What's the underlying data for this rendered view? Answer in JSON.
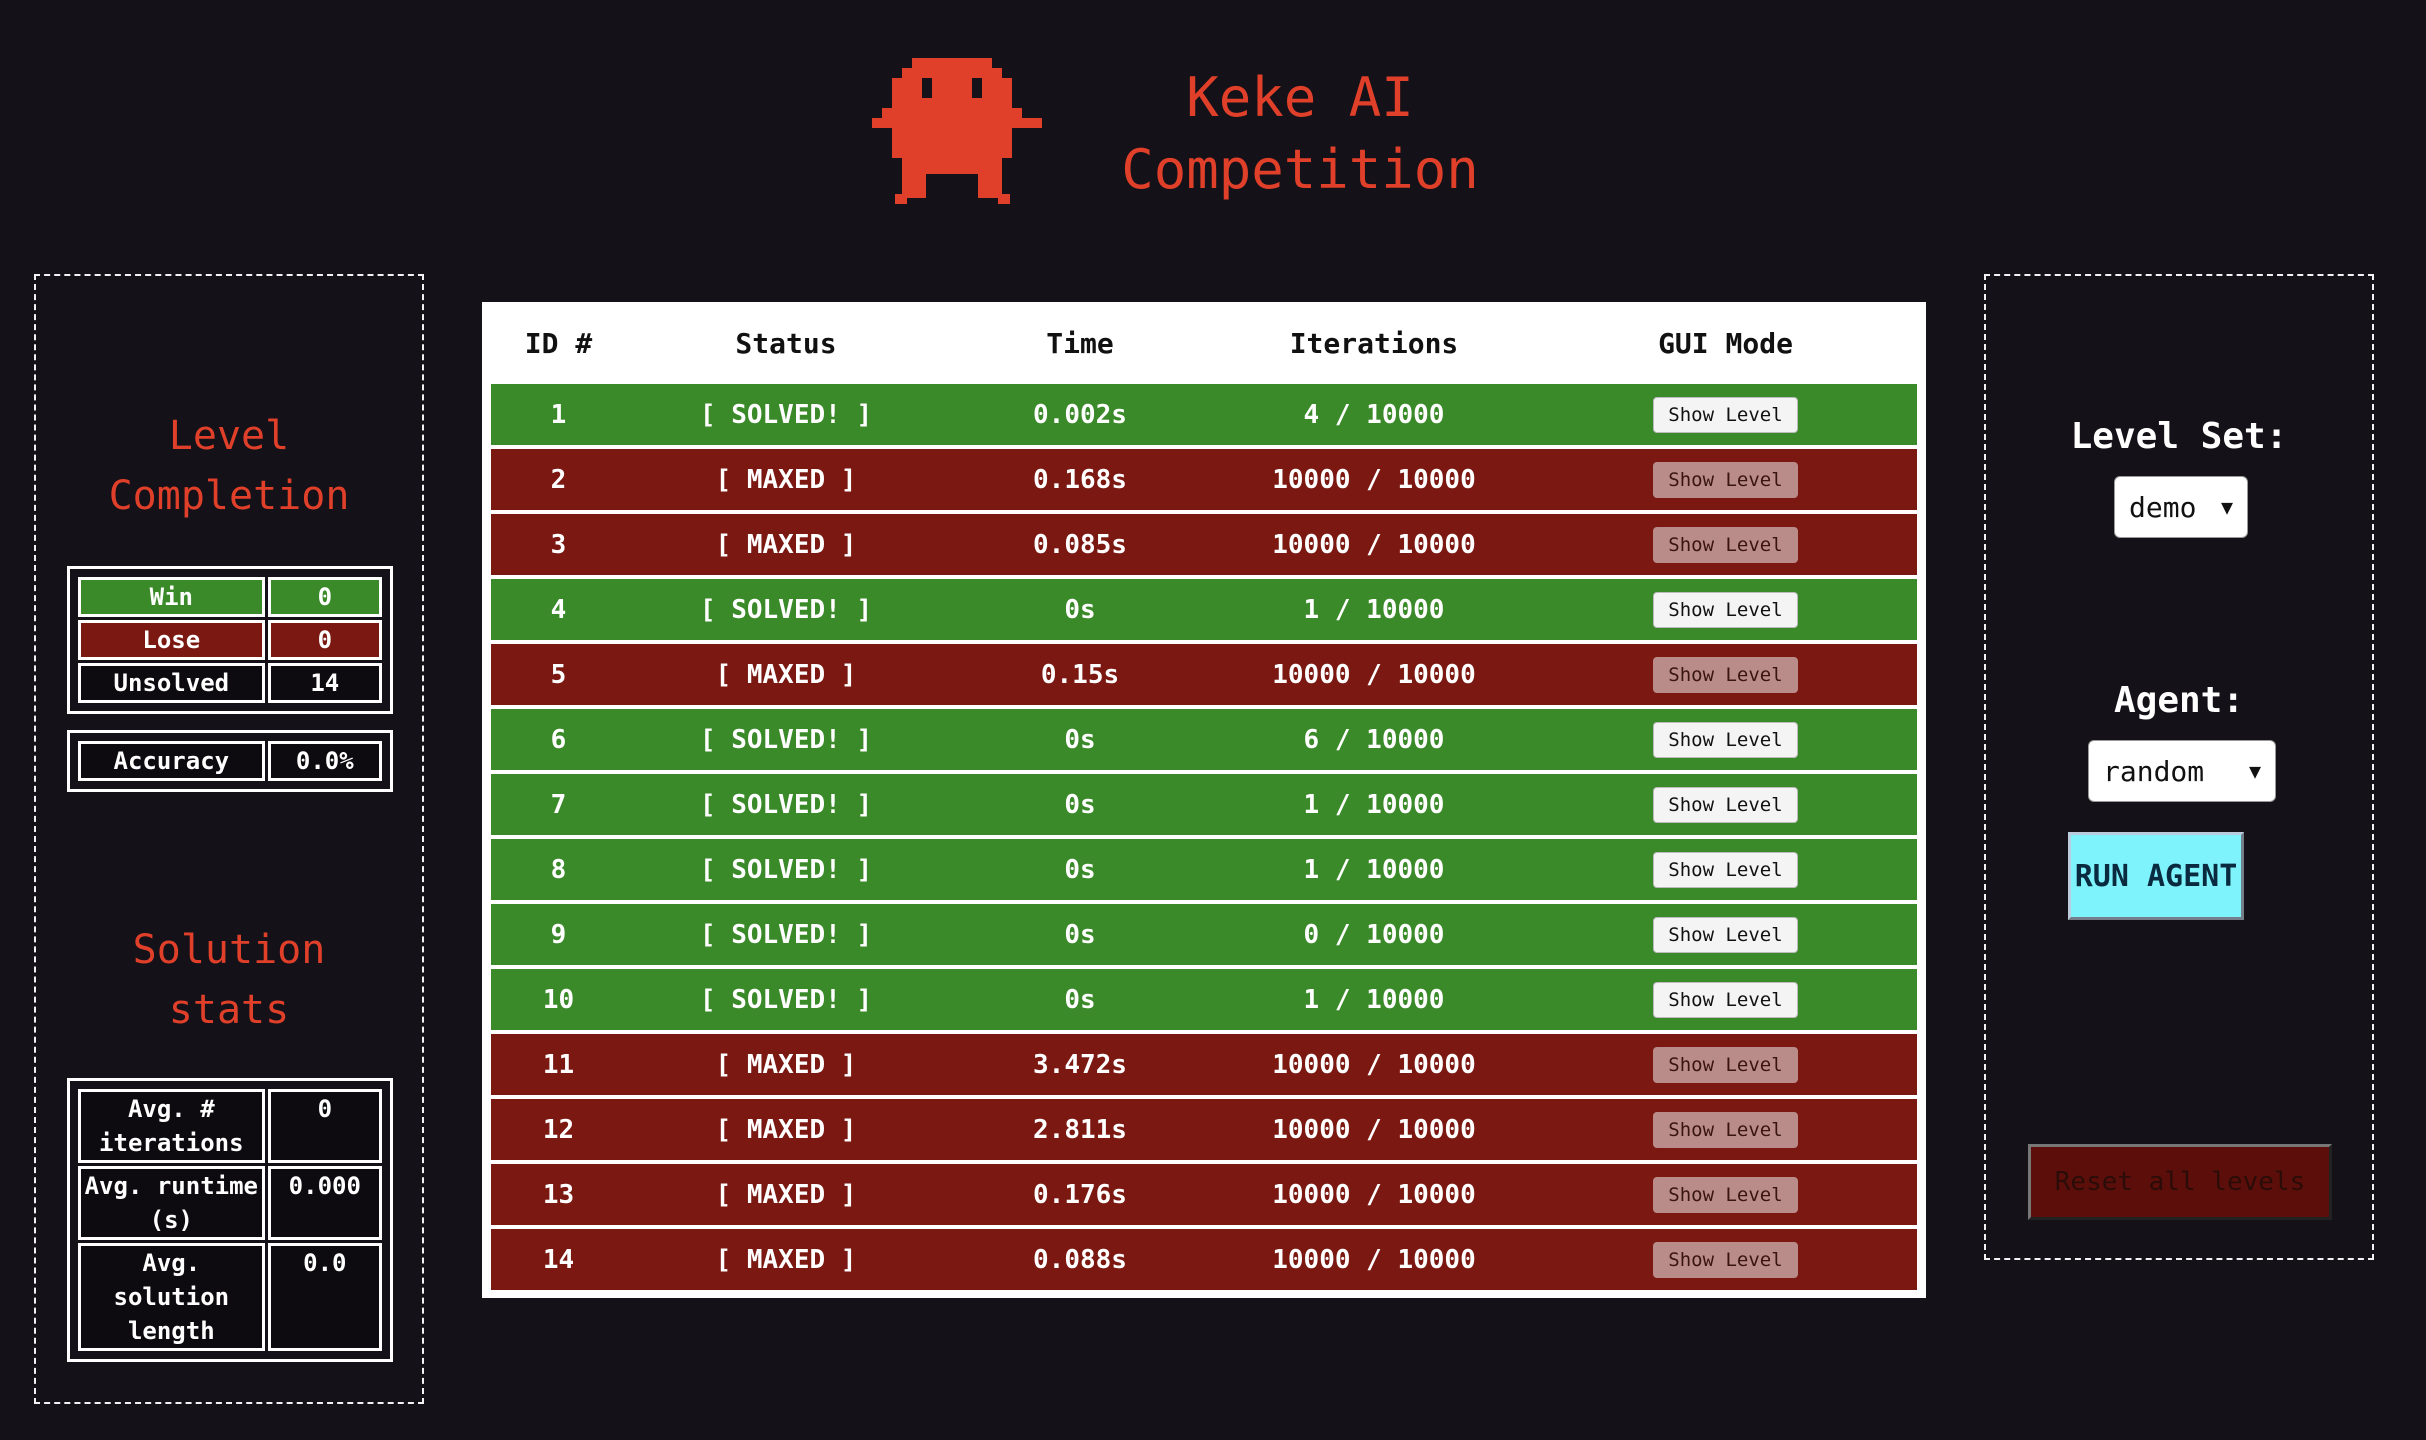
{
  "header": {
    "title_line1": "Keke AI",
    "title_line2": "Competition"
  },
  "left": {
    "completion_title_line1": "Level",
    "completion_title_line2": "Completion",
    "win_label": "Win",
    "win_value": "0",
    "lose_label": "Lose",
    "lose_value": "0",
    "unsolved_label": "Unsolved",
    "unsolved_value": "14",
    "accuracy_label": "Accuracy",
    "accuracy_value": "0.0%",
    "solution_title_line1": "Solution",
    "solution_title_line2": "stats",
    "avg_iter_label": "Avg. # iterations",
    "avg_iter_value": "0",
    "avg_runtime_label": "Avg. runtime (s)",
    "avg_runtime_value": "0.000",
    "avg_length_label": "Avg. solution length",
    "avg_length_value": "0.0"
  },
  "table": {
    "headers": [
      "ID #",
      "Status",
      "Time",
      "Iterations",
      "GUI Mode"
    ],
    "button_label": "Show Level",
    "rows": [
      {
        "id": "1",
        "status": "[ SOLVED! ]",
        "time": "0.002s",
        "iterations": "4 / 10000",
        "result": "win"
      },
      {
        "id": "2",
        "status": "[ MAXED ]",
        "time": "0.168s",
        "iterations": "10000 / 10000",
        "result": "lose"
      },
      {
        "id": "3",
        "status": "[ MAXED ]",
        "time": "0.085s",
        "iterations": "10000 / 10000",
        "result": "lose"
      },
      {
        "id": "4",
        "status": "[ SOLVED! ]",
        "time": "0s",
        "iterations": "1 / 10000",
        "result": "win"
      },
      {
        "id": "5",
        "status": "[ MAXED ]",
        "time": "0.15s",
        "iterations": "10000 / 10000",
        "result": "lose"
      },
      {
        "id": "6",
        "status": "[ SOLVED! ]",
        "time": "0s",
        "iterations": "6 / 10000",
        "result": "win"
      },
      {
        "id": "7",
        "status": "[ SOLVED! ]",
        "time": "0s",
        "iterations": "1 / 10000",
        "result": "win"
      },
      {
        "id": "8",
        "status": "[ SOLVED! ]",
        "time": "0s",
        "iterations": "1 / 10000",
        "result": "win"
      },
      {
        "id": "9",
        "status": "[ SOLVED! ]",
        "time": "0s",
        "iterations": "0 / 10000",
        "result": "win"
      },
      {
        "id": "10",
        "status": "[ SOLVED! ]",
        "time": "0s",
        "iterations": "1 / 10000",
        "result": "win"
      },
      {
        "id": "11",
        "status": "[ MAXED ]",
        "time": "3.472s",
        "iterations": "10000 / 10000",
        "result": "lose"
      },
      {
        "id": "12",
        "status": "[ MAXED ]",
        "time": "2.811s",
        "iterations": "10000 / 10000",
        "result": "lose"
      },
      {
        "id": "13",
        "status": "[ MAXED ]",
        "time": "0.176s",
        "iterations": "10000 / 10000",
        "result": "lose"
      },
      {
        "id": "14",
        "status": "[ MAXED ]",
        "time": "0.088s",
        "iterations": "10000 / 10000",
        "result": "lose"
      }
    ]
  },
  "right": {
    "level_set_label": "Level Set:",
    "level_set_value": "demo",
    "agent_label": "Agent:",
    "agent_value": "random",
    "run_button": "RUN AGENT",
    "reset_button": "Reset all levels"
  },
  "colors": {
    "background": "#141118",
    "accent_red": "#e0402a",
    "win_green": "#3a8a2a",
    "lose_red": "#7b1812",
    "run_cyan": "#7ff3fb"
  }
}
